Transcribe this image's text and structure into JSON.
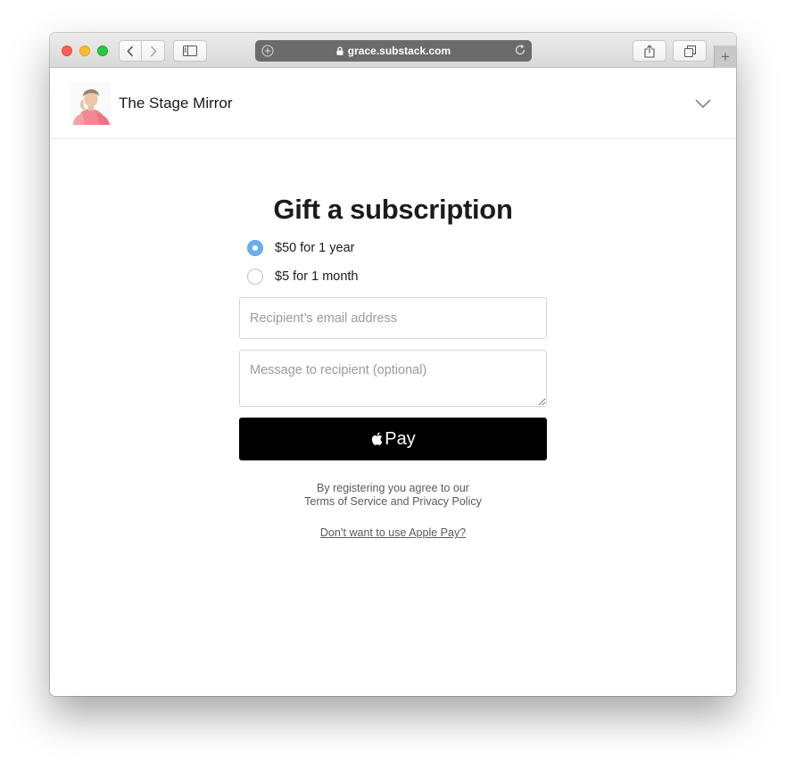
{
  "browser": {
    "url": "grace.substack.com",
    "new_tab_label": "+"
  },
  "header": {
    "publication_name": "The Stage Mirror"
  },
  "gift": {
    "title": "Gift a subscription",
    "options": [
      {
        "label": "$50 for 1 year",
        "selected": true
      },
      {
        "label": "$5 for 1 month",
        "selected": false
      }
    ],
    "email_placeholder": "Recipient’s email address",
    "message_placeholder": "Message to recipient (optional)",
    "pay_button_label": "Pay",
    "legal_line1": "By registering you agree to our",
    "terms_link": "Terms of Service",
    "legal_and": "and",
    "privacy_link": "Privacy Policy",
    "alt_payment_link": "Don’t want to use Apple Pay?"
  },
  "colors": {
    "radio_selected": "#6ab0ef",
    "pay_button": "#000000"
  }
}
